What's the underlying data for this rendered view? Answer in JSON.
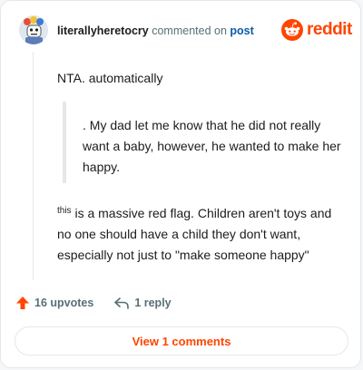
{
  "comment": {
    "username": "literallyheretocry",
    "action_text": "commented on",
    "link_text": "post",
    "intro": "NTA. automatically",
    "quote": ". My dad let me know that he did not really want a baby, however, he wanted to make her happy.",
    "body_sup": "this",
    "body": " is a massive red flag. Children aren't toys and no one should have a child they don't want, especially not just to \"make someone happy\""
  },
  "brand": {
    "name": "reddit",
    "color": "#ff4500",
    "icon": "reddit-logo-icon"
  },
  "actions": {
    "upvotes": "16 upvotes",
    "upvote_icon": "upvote-arrow-icon",
    "replies": "1 reply",
    "reply_icon": "reply-arrow-icon"
  },
  "view_button": {
    "label": "View 1 comments"
  }
}
